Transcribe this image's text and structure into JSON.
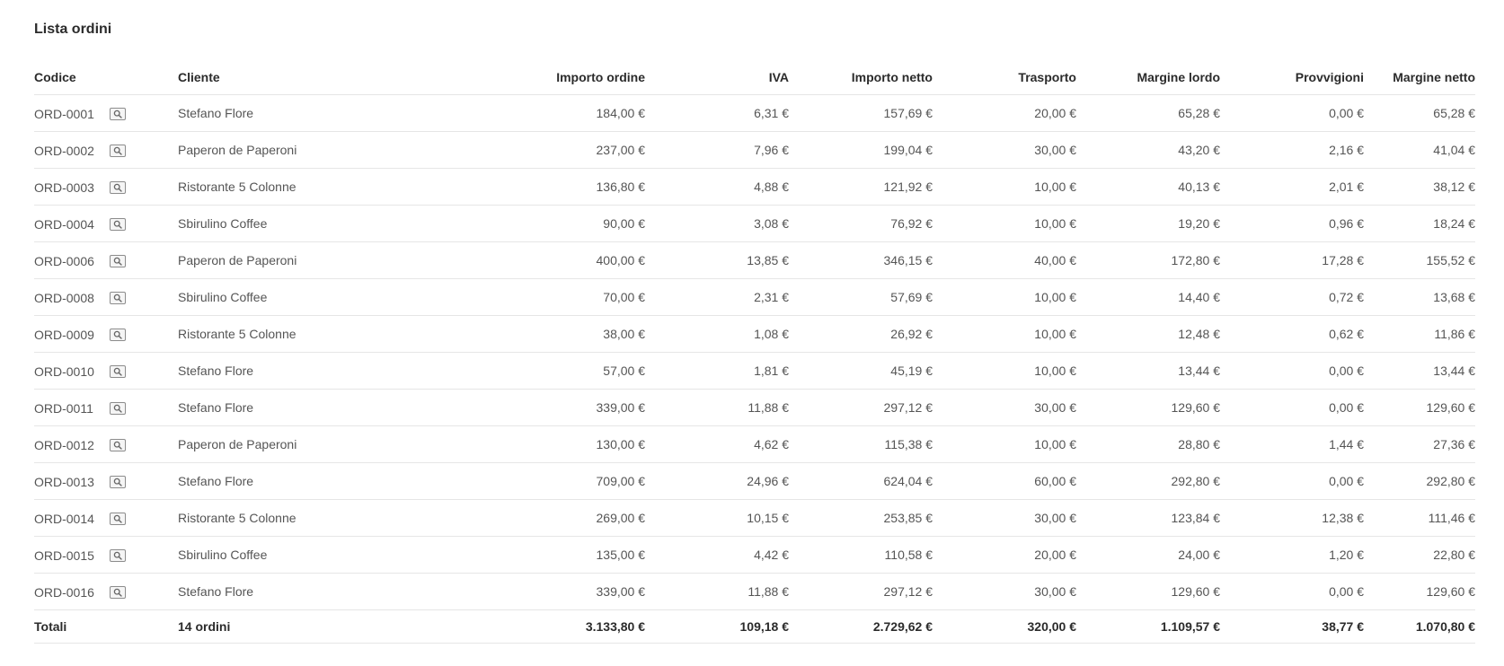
{
  "title": "Lista ordini",
  "columns": {
    "codice": "Codice",
    "cliente": "Cliente",
    "importo_ordine": "Importo ordine",
    "iva": "IVA",
    "importo_netto": "Importo netto",
    "trasporto": "Trasporto",
    "margine_lordo": "Margine lordo",
    "provvigioni": "Provvigioni",
    "margine_netto": "Margine netto"
  },
  "icons": {
    "row_action": "search-icon"
  },
  "rows": [
    {
      "codice": "ORD-0001",
      "cliente": "Stefano Flore",
      "importo_ordine": "184,00 €",
      "iva": "6,31 €",
      "importo_netto": "157,69 €",
      "trasporto": "20,00 €",
      "margine_lordo": "65,28 €",
      "provvigioni": "0,00 €",
      "margine_netto": "65,28 €"
    },
    {
      "codice": "ORD-0002",
      "cliente": "Paperon de Paperoni",
      "importo_ordine": "237,00 €",
      "iva": "7,96 €",
      "importo_netto": "199,04 €",
      "trasporto": "30,00 €",
      "margine_lordo": "43,20 €",
      "provvigioni": "2,16 €",
      "margine_netto": "41,04 €"
    },
    {
      "codice": "ORD-0003",
      "cliente": "Ristorante 5 Colonne",
      "importo_ordine": "136,80 €",
      "iva": "4,88 €",
      "importo_netto": "121,92 €",
      "trasporto": "10,00 €",
      "margine_lordo": "40,13 €",
      "provvigioni": "2,01 €",
      "margine_netto": "38,12 €"
    },
    {
      "codice": "ORD-0004",
      "cliente": "Sbirulino Coffee",
      "importo_ordine": "90,00 €",
      "iva": "3,08 €",
      "importo_netto": "76,92 €",
      "trasporto": "10,00 €",
      "margine_lordo": "19,20 €",
      "provvigioni": "0,96 €",
      "margine_netto": "18,24 €"
    },
    {
      "codice": "ORD-0006",
      "cliente": "Paperon de Paperoni",
      "importo_ordine": "400,00 €",
      "iva": "13,85 €",
      "importo_netto": "346,15 €",
      "trasporto": "40,00 €",
      "margine_lordo": "172,80 €",
      "provvigioni": "17,28 €",
      "margine_netto": "155,52 €"
    },
    {
      "codice": "ORD-0008",
      "cliente": "Sbirulino Coffee",
      "importo_ordine": "70,00 €",
      "iva": "2,31 €",
      "importo_netto": "57,69 €",
      "trasporto": "10,00 €",
      "margine_lordo": "14,40 €",
      "provvigioni": "0,72 €",
      "margine_netto": "13,68 €"
    },
    {
      "codice": "ORD-0009",
      "cliente": "Ristorante 5 Colonne",
      "importo_ordine": "38,00 €",
      "iva": "1,08 €",
      "importo_netto": "26,92 €",
      "trasporto": "10,00 €",
      "margine_lordo": "12,48 €",
      "provvigioni": "0,62 €",
      "margine_netto": "11,86 €"
    },
    {
      "codice": "ORD-0010",
      "cliente": "Stefano Flore",
      "importo_ordine": "57,00 €",
      "iva": "1,81 €",
      "importo_netto": "45,19 €",
      "trasporto": "10,00 €",
      "margine_lordo": "13,44 €",
      "provvigioni": "0,00 €",
      "margine_netto": "13,44 €"
    },
    {
      "codice": "ORD-0011",
      "cliente": "Stefano Flore",
      "importo_ordine": "339,00 €",
      "iva": "11,88 €",
      "importo_netto": "297,12 €",
      "trasporto": "30,00 €",
      "margine_lordo": "129,60 €",
      "provvigioni": "0,00 €",
      "margine_netto": "129,60 €"
    },
    {
      "codice": "ORD-0012",
      "cliente": "Paperon de Paperoni",
      "importo_ordine": "130,00 €",
      "iva": "4,62 €",
      "importo_netto": "115,38 €",
      "trasporto": "10,00 €",
      "margine_lordo": "28,80 €",
      "provvigioni": "1,44 €",
      "margine_netto": "27,36 €"
    },
    {
      "codice": "ORD-0013",
      "cliente": "Stefano Flore",
      "importo_ordine": "709,00 €",
      "iva": "24,96 €",
      "importo_netto": "624,04 €",
      "trasporto": "60,00 €",
      "margine_lordo": "292,80 €",
      "provvigioni": "0,00 €",
      "margine_netto": "292,80 €"
    },
    {
      "codice": "ORD-0014",
      "cliente": "Ristorante 5 Colonne",
      "importo_ordine": "269,00 €",
      "iva": "10,15 €",
      "importo_netto": "253,85 €",
      "trasporto": "30,00 €",
      "margine_lordo": "123,84 €",
      "provvigioni": "12,38 €",
      "margine_netto": "111,46 €"
    },
    {
      "codice": "ORD-0015",
      "cliente": "Sbirulino Coffee",
      "importo_ordine": "135,00 €",
      "iva": "4,42 €",
      "importo_netto": "110,58 €",
      "trasporto": "20,00 €",
      "margine_lordo": "24,00 €",
      "provvigioni": "1,20 €",
      "margine_netto": "22,80 €"
    },
    {
      "codice": "ORD-0016",
      "cliente": "Stefano Flore",
      "importo_ordine": "339,00 €",
      "iva": "11,88 €",
      "importo_netto": "297,12 €",
      "trasporto": "30,00 €",
      "margine_lordo": "129,60 €",
      "provvigioni": "0,00 €",
      "margine_netto": "129,60 €"
    }
  ],
  "totals": {
    "label": "Totali",
    "count": "14 ordini",
    "importo_ordine": "3.133,80 €",
    "iva": "109,18 €",
    "importo_netto": "2.729,62 €",
    "trasporto": "320,00 €",
    "margine_lordo": "1.109,57 €",
    "provvigioni": "38,77 €",
    "margine_netto": "1.070,80 €"
  }
}
